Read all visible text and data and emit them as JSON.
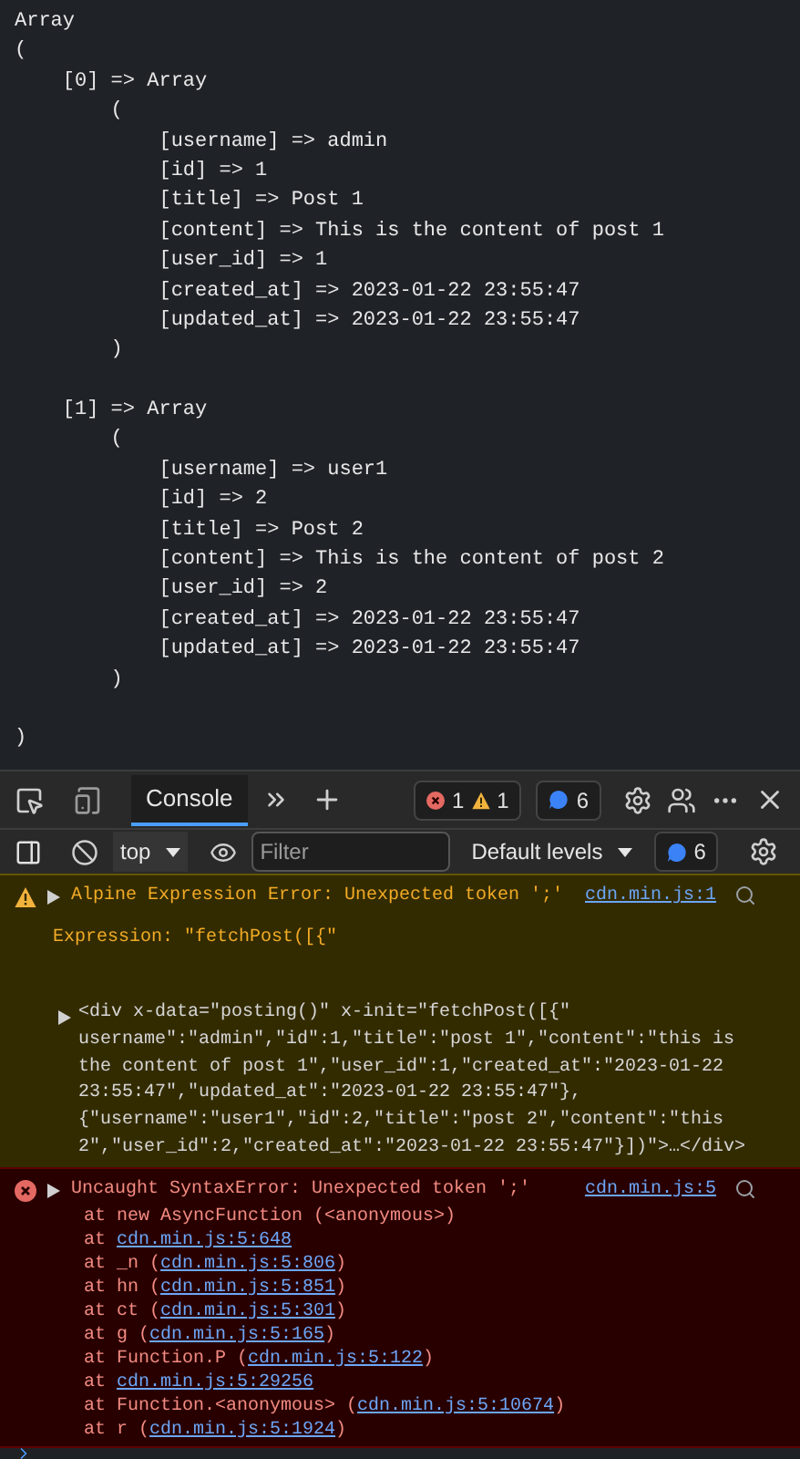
{
  "page_output": {
    "blocks": [
      [
        "Array",
        "(",
        "    [0] => Array",
        "        (",
        "            [username] => admin",
        "            [id] => 1",
        "            [title] => Post 1",
        "            [content] => This is the content of post 1",
        "            [user_id] => 1",
        "            [created_at] => 2023-01-22 23:55:47",
        "            [updated_at] => 2023-01-22 23:55:47",
        "        )"
      ],
      [
        "    [1] => Array",
        "        (",
        "            [username] => user1",
        "            [id] => 2",
        "            [title] => Post 2",
        "            [content] => This is the content of post 2",
        "            [user_id] => 2",
        "            [created_at] => 2023-01-22 23:55:47",
        "            [updated_at] => 2023-01-22 23:55:47",
        "        )"
      ],
      [
        ")"
      ]
    ]
  },
  "devtools": {
    "tabs": [
      {
        "label": "Console",
        "selected": true
      }
    ],
    "error_count": "1",
    "warning_count": "1",
    "message_count": "6",
    "context": "top",
    "filter": {
      "placeholder": "Filter"
    },
    "levels": "Default levels",
    "issues_count": "6"
  },
  "console": {
    "messages": [
      {
        "kind": "warning",
        "text": "Alpine Expression Error: Unexpected token ';'",
        "source": "cdn.min.js:1",
        "detail": "Expression: \"fetchPost([{\"",
        "element_lines": [
          "<div x-data=\"posting()\" x-init=\"fetchPost([{\"",
          "username\":\"admin\",\"id\":1,\"title\":\"post 1\",\"content\":\"this is",
          "the content of post 1\",\"user_id\":1,\"created_at\":\"2023-01-22",
          "23:55:47\",\"updated_at\":\"2023-01-22 23:55:47\"},",
          "{\"username\":\"user1\",\"id\":2,\"title\":\"post 2\",\"content\":\"this",
          "2\",\"user_id\":2,\"created_at\":\"2023-01-22 23:55:47\"}])\">…</div>"
        ]
      },
      {
        "kind": "error",
        "text": "Uncaught SyntaxError: Unexpected token ';'",
        "source": "cdn.min.js:5",
        "stack": [
          {
            "before": "at new AsyncFunction (<anonymous>)"
          },
          {
            "before": "at ",
            "link": "cdn.min.js:5:648"
          },
          {
            "before": "at _n (",
            "link": "cdn.min.js:5:806",
            "after": ")"
          },
          {
            "before": "at hn (",
            "link": "cdn.min.js:5:851",
            "after": ")"
          },
          {
            "before": "at ct (",
            "link": "cdn.min.js:5:301",
            "after": ")"
          },
          {
            "before": "at g (",
            "link": "cdn.min.js:5:165",
            "after": ")"
          },
          {
            "before": "at Function.P (",
            "link": "cdn.min.js:5:122",
            "after": ")"
          },
          {
            "before": "at ",
            "link": "cdn.min.js:5:29256"
          },
          {
            "before": "at Function.<anonymous> (",
            "link": "cdn.min.js:5:10674",
            "after": ")"
          },
          {
            "before": "at r (",
            "link": "cdn.min.js:5:1924",
            "after": ")"
          }
        ]
      }
    ]
  }
}
